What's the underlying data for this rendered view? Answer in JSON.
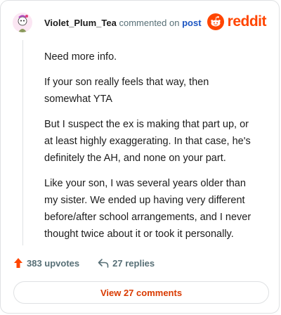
{
  "header": {
    "username": "Violet_Plum_Tea",
    "commented_on": "commented on",
    "post_link": "post"
  },
  "logo": {
    "word": "reddit",
    "brand_color": "#ff4500"
  },
  "comment": {
    "paragraphs": [
      "Need more info.",
      "If your son really feels that way, then somewhat YTA",
      "But I suspect the ex is making that part up, or at least highly exaggerating. In that case, he's definitely the AH, and none on your part.",
      "Like your son, I was several years older than my sister. We ended up having very different before/after school arrangements, and I never thought twice about it or took it personally."
    ]
  },
  "actions": {
    "upvotes": "383 upvotes",
    "replies": "27 replies"
  },
  "view_comments": {
    "label": "View 27 comments"
  },
  "icons": {
    "upvote": "upvote-arrow-icon",
    "reply": "reply-arrow-icon",
    "logo": "reddit-snoo-icon",
    "avatar": "avatar-icon"
  }
}
